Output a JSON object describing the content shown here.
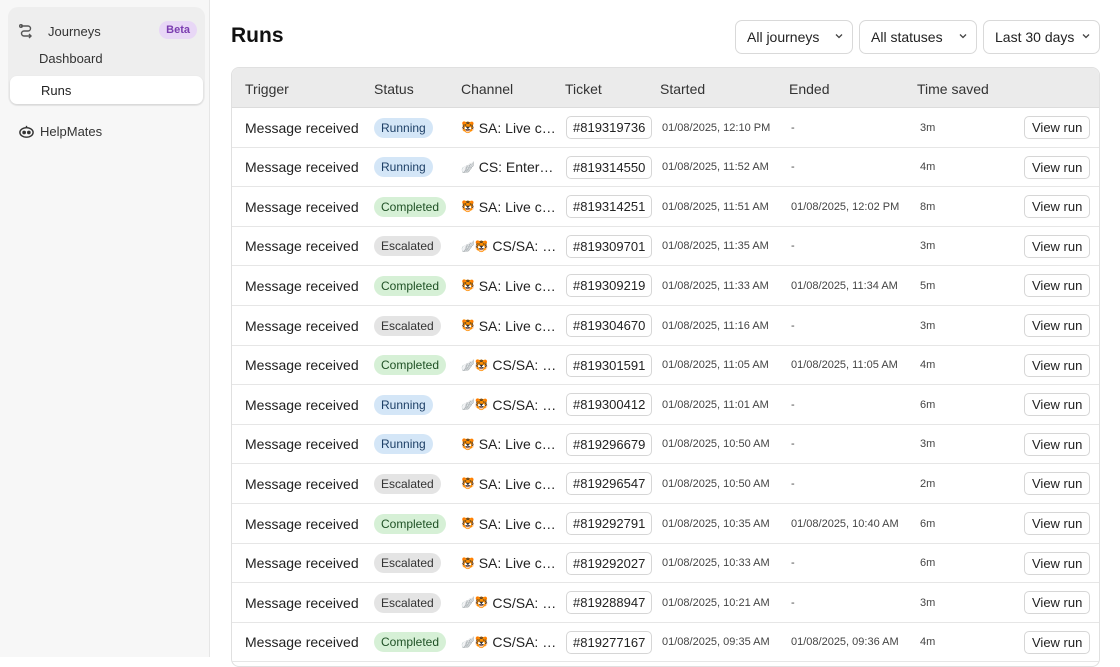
{
  "sidebar": {
    "group_label": "Journeys",
    "beta_label": "Beta",
    "items": [
      {
        "label": "Dashboard"
      },
      {
        "label": "Runs"
      }
    ],
    "helpmates_label": "HelpMates"
  },
  "page": {
    "title": "Runs"
  },
  "filters": {
    "journeys": "All journeys",
    "statuses": "All statuses",
    "range": "Last 30 days"
  },
  "table": {
    "headers": [
      "Trigger",
      "Status",
      "Channel",
      "Ticket",
      "Started",
      "Ended",
      "Time saved"
    ],
    "view_label": "View run",
    "rows": [
      {
        "trigger": "Message received",
        "status": "Running",
        "status_kind": "running",
        "channel_icon": "🐯",
        "channel": "SA: Live ch...",
        "ticket": "#819319736",
        "started": "01/08/2025, 12:10 PM",
        "ended": "-",
        "saved": "3m"
      },
      {
        "trigger": "Message received",
        "status": "Running",
        "status_kind": "running",
        "channel_icon": "🪽",
        "channel": "CS: Enterpr...",
        "ticket": "#819314550",
        "started": "01/08/2025, 11:52 AM",
        "ended": "-",
        "saved": "4m"
      },
      {
        "trigger": "Message received",
        "status": "Completed",
        "status_kind": "completed",
        "channel_icon": "🐯",
        "channel": "SA: Live ch...",
        "ticket": "#819314251",
        "started": "01/08/2025, 11:51 AM",
        "ended": "01/08/2025, 12:02 PM",
        "saved": "8m"
      },
      {
        "trigger": "Message received",
        "status": "Escalated",
        "status_kind": "escalated",
        "channel_icon": "🪽🐯",
        "channel": "CS/SA: W...",
        "ticket": "#819309701",
        "started": "01/08/2025, 11:35 AM",
        "ended": "-",
        "saved": "3m"
      },
      {
        "trigger": "Message received",
        "status": "Completed",
        "status_kind": "completed",
        "channel_icon": "🐯",
        "channel": "SA: Live ch...",
        "ticket": "#819309219",
        "started": "01/08/2025, 11:33 AM",
        "ended": "01/08/2025, 11:34 AM",
        "saved": "5m"
      },
      {
        "trigger": "Message received",
        "status": "Escalated",
        "status_kind": "escalated",
        "channel_icon": "🐯",
        "channel": "SA: Live ch...",
        "ticket": "#819304670",
        "started": "01/08/2025, 11:16 AM",
        "ended": "-",
        "saved": "3m"
      },
      {
        "trigger": "Message received",
        "status": "Completed",
        "status_kind": "completed",
        "channel_icon": "🪽🐯",
        "channel": "CS/SA: W...",
        "ticket": "#819301591",
        "started": "01/08/2025, 11:05 AM",
        "ended": "01/08/2025, 11:05 AM",
        "saved": "4m"
      },
      {
        "trigger": "Message received",
        "status": "Running",
        "status_kind": "running",
        "channel_icon": "🪽🐯",
        "channel": "CS/SA: W...",
        "ticket": "#819300412",
        "started": "01/08/2025, 11:01 AM",
        "ended": "-",
        "saved": "6m"
      },
      {
        "trigger": "Message received",
        "status": "Running",
        "status_kind": "running",
        "channel_icon": "🐯",
        "channel": "SA: Live ch...",
        "ticket": "#819296679",
        "started": "01/08/2025, 10:50 AM",
        "ended": "-",
        "saved": "3m"
      },
      {
        "trigger": "Message received",
        "status": "Escalated",
        "status_kind": "escalated",
        "channel_icon": "🐯",
        "channel": "SA: Live ch...",
        "ticket": "#819296547",
        "started": "01/08/2025, 10:50 AM",
        "ended": "-",
        "saved": "2m"
      },
      {
        "trigger": "Message received",
        "status": "Completed",
        "status_kind": "completed",
        "channel_icon": "🐯",
        "channel": "SA: Live ch...",
        "ticket": "#819292791",
        "started": "01/08/2025, 10:35 AM",
        "ended": "01/08/2025, 10:40 AM",
        "saved": "6m"
      },
      {
        "trigger": "Message received",
        "status": "Escalated",
        "status_kind": "escalated",
        "channel_icon": "🐯",
        "channel": "SA: Live ch...",
        "ticket": "#819292027",
        "started": "01/08/2025, 10:33 AM",
        "ended": "-",
        "saved": "6m"
      },
      {
        "trigger": "Message received",
        "status": "Escalated",
        "status_kind": "escalated",
        "channel_icon": "🪽🐯",
        "channel": "CS/SA: W...",
        "ticket": "#819288947",
        "started": "01/08/2025, 10:21 AM",
        "ended": "-",
        "saved": "3m"
      },
      {
        "trigger": "Message received",
        "status": "Completed",
        "status_kind": "completed",
        "channel_icon": "🪽🐯",
        "channel": "CS/SA: W...",
        "ticket": "#819277167",
        "started": "01/08/2025, 09:35 AM",
        "ended": "01/08/2025, 09:36 AM",
        "saved": "4m"
      }
    ]
  }
}
